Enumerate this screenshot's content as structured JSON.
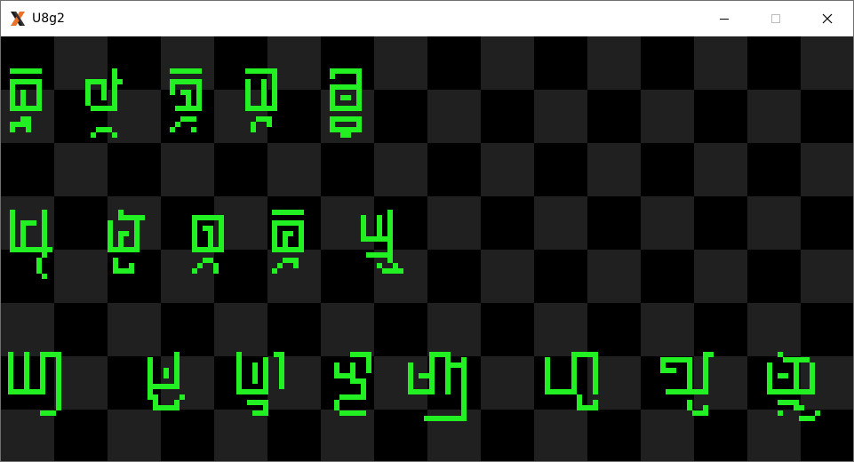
{
  "window": {
    "title": "U8g2",
    "app_icon": "x-logo-icon",
    "controls": [
      "minimize-icon",
      "maximize-icon",
      "close-icon"
    ]
  },
  "canvas": {
    "description_colors": {
      "dark_square": "#000000",
      "light_square": "#202020",
      "glyph_color": "#22f022"
    },
    "rows": [
      {
        "name": "row-1",
        "glyph_count": 5
      },
      {
        "name": "row-2",
        "glyph_count": 5
      },
      {
        "name": "row-3",
        "glyph_count": 8
      }
    ]
  }
}
